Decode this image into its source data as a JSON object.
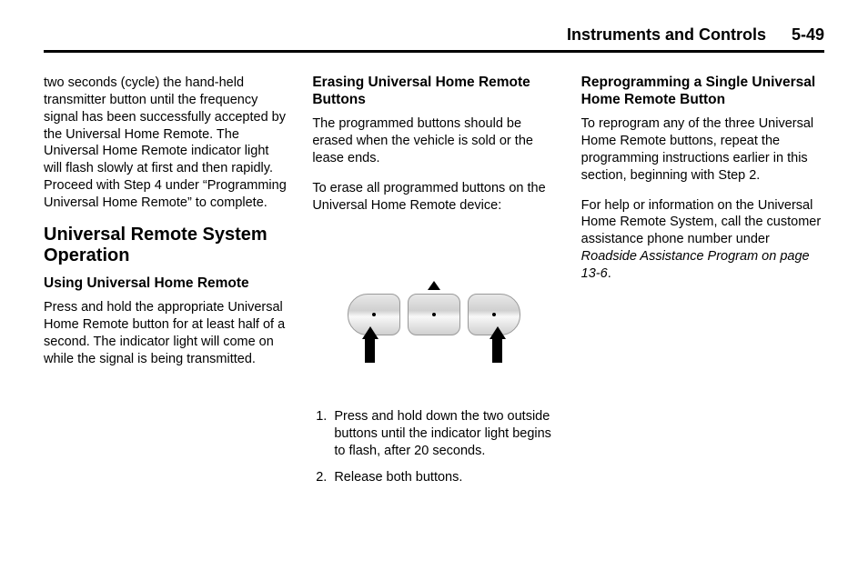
{
  "header": {
    "title": "Instruments and Controls",
    "page_number": "5-49"
  },
  "col1": {
    "continued_para": "two seconds (cycle) the hand-held transmitter button until the frequency signal has been successfully accepted by the Universal Home Remote. The Universal Home Remote indicator light will flash slowly at first and then rapidly. Proceed with Step 4 under “Programming Universal Home Remote” to complete.",
    "section_title": "Universal Remote System Operation",
    "subheading": "Using Universal Home Remote",
    "para1": "Press and hold the appropriate Universal Home Remote button for at least half of a second. The indicator light will come on while the signal is being transmitted."
  },
  "col2": {
    "subheading": "Erasing Universal Home Remote Buttons",
    "para1": "The programmed buttons should be erased when the vehicle is sold or the lease ends.",
    "para2": "To erase all programmed buttons on the Universal Home Remote device:",
    "steps": [
      "Press and hold down the two outside buttons until the indicator light begins to flash, after 20 seconds.",
      "Release both buttons."
    ]
  },
  "col3": {
    "subheading": "Reprogramming a Single Universal Home Remote Button",
    "para1": "To reprogram any of the three Universal Home Remote buttons, repeat the programming instructions earlier in this section, beginning with Step 2.",
    "para2_prefix": "For help or information on the Universal Home Remote System, call the customer assistance phone number under ",
    "para2_italic": "Roadside Assistance Program on page 13-6",
    "para2_suffix": "."
  }
}
